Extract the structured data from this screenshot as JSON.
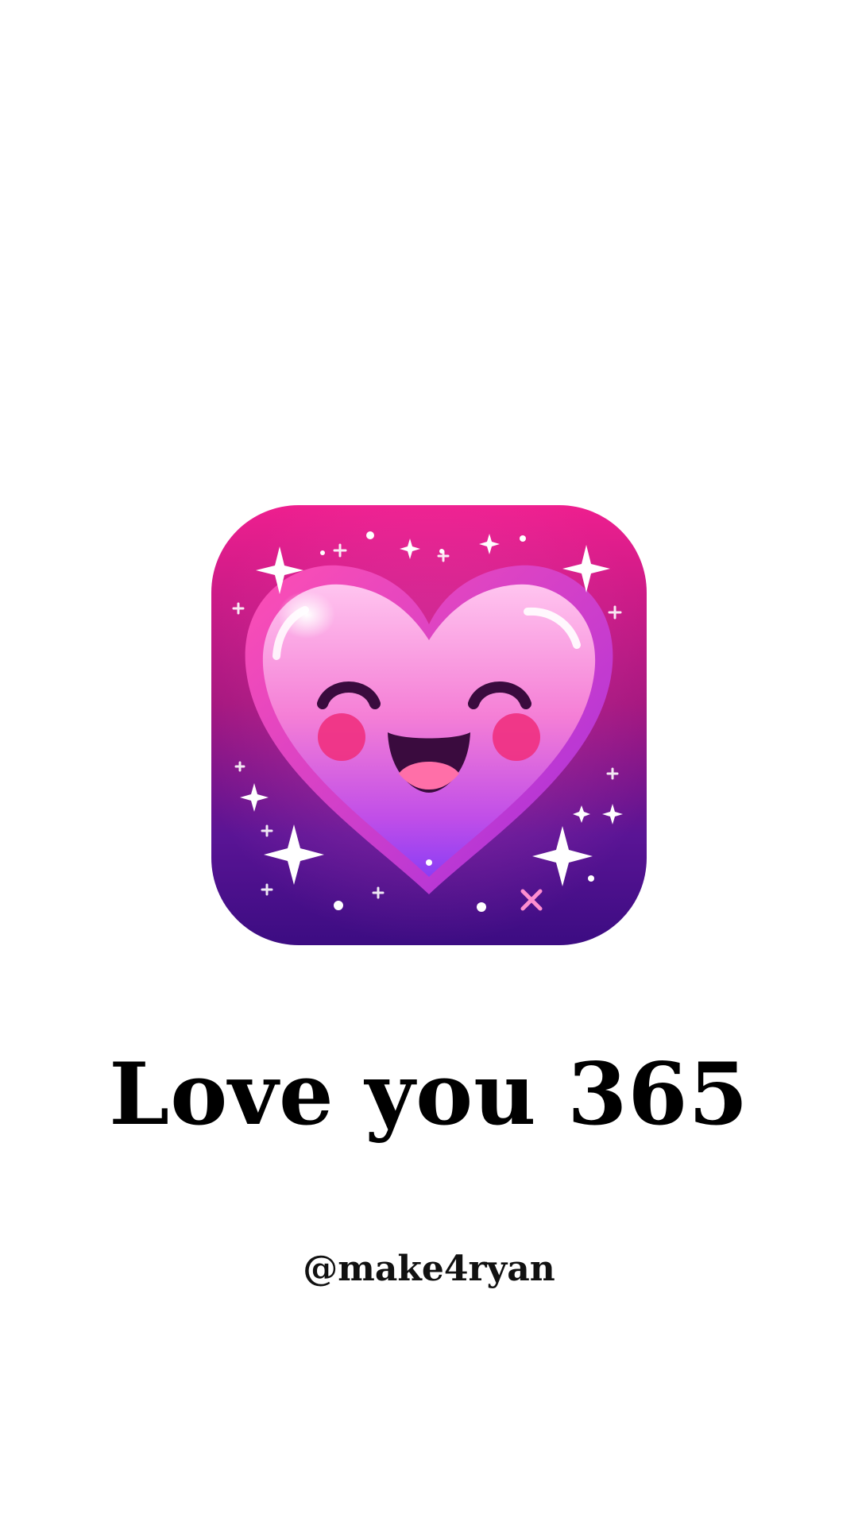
{
  "splash": {
    "app_icon": "smiling-heart-icon",
    "title": "Love you 365",
    "handle": "@make4ryan"
  },
  "colors": {
    "background": "#ffffff",
    "icon_top": "#e7188a",
    "icon_bottom": "#3f0f86",
    "heart_light": "#ffb3e8",
    "heart_pink": "#f45cc4",
    "heart_purple": "#9a3bf0",
    "text": "#000000"
  }
}
